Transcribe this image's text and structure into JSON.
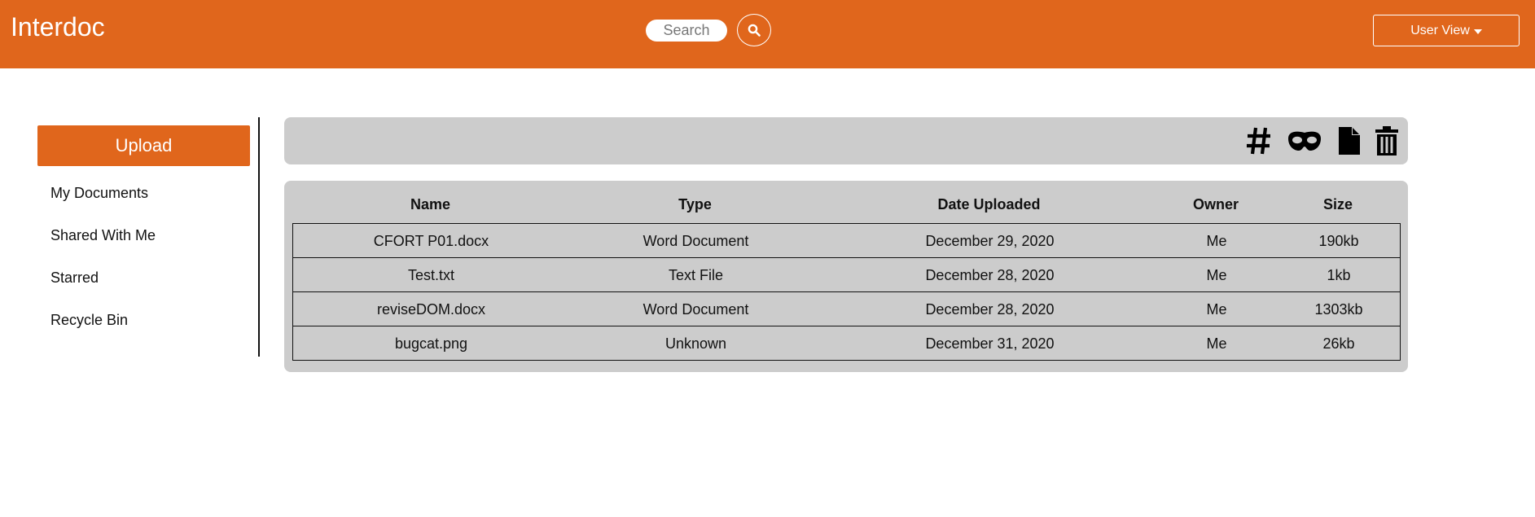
{
  "header": {
    "brand": "Interdoc",
    "search_placeholder": "Search",
    "user_view_label": "User View"
  },
  "sidebar": {
    "upload_label": "Upload",
    "items": [
      {
        "label": "My Documents"
      },
      {
        "label": "Shared With Me"
      },
      {
        "label": "Starred"
      },
      {
        "label": "Recycle Bin"
      }
    ]
  },
  "toolbar": {
    "icons": [
      "hash-icon",
      "mask-icon",
      "file-icon",
      "trash-icon"
    ]
  },
  "table": {
    "columns": [
      "Name",
      "Type",
      "Date Uploaded",
      "Owner",
      "Size"
    ],
    "rows": [
      {
        "name": "CFORT P01.docx",
        "type": "Word Document",
        "date": "December 29, 2020",
        "owner": "Me",
        "size": "190kb"
      },
      {
        "name": "Test.txt",
        "type": "Text File",
        "date": "December 28, 2020",
        "owner": "Me",
        "size": "1kb"
      },
      {
        "name": "reviseDOM.docx",
        "type": "Word Document",
        "date": "December 28, 2020",
        "owner": "Me",
        "size": "1303kb"
      },
      {
        "name": "bugcat.png",
        "type": "Unknown",
        "date": "December 31, 2020",
        "owner": "Me",
        "size": "26kb"
      }
    ]
  },
  "colors": {
    "brand": "#e0661c",
    "panel": "#cccccc"
  }
}
